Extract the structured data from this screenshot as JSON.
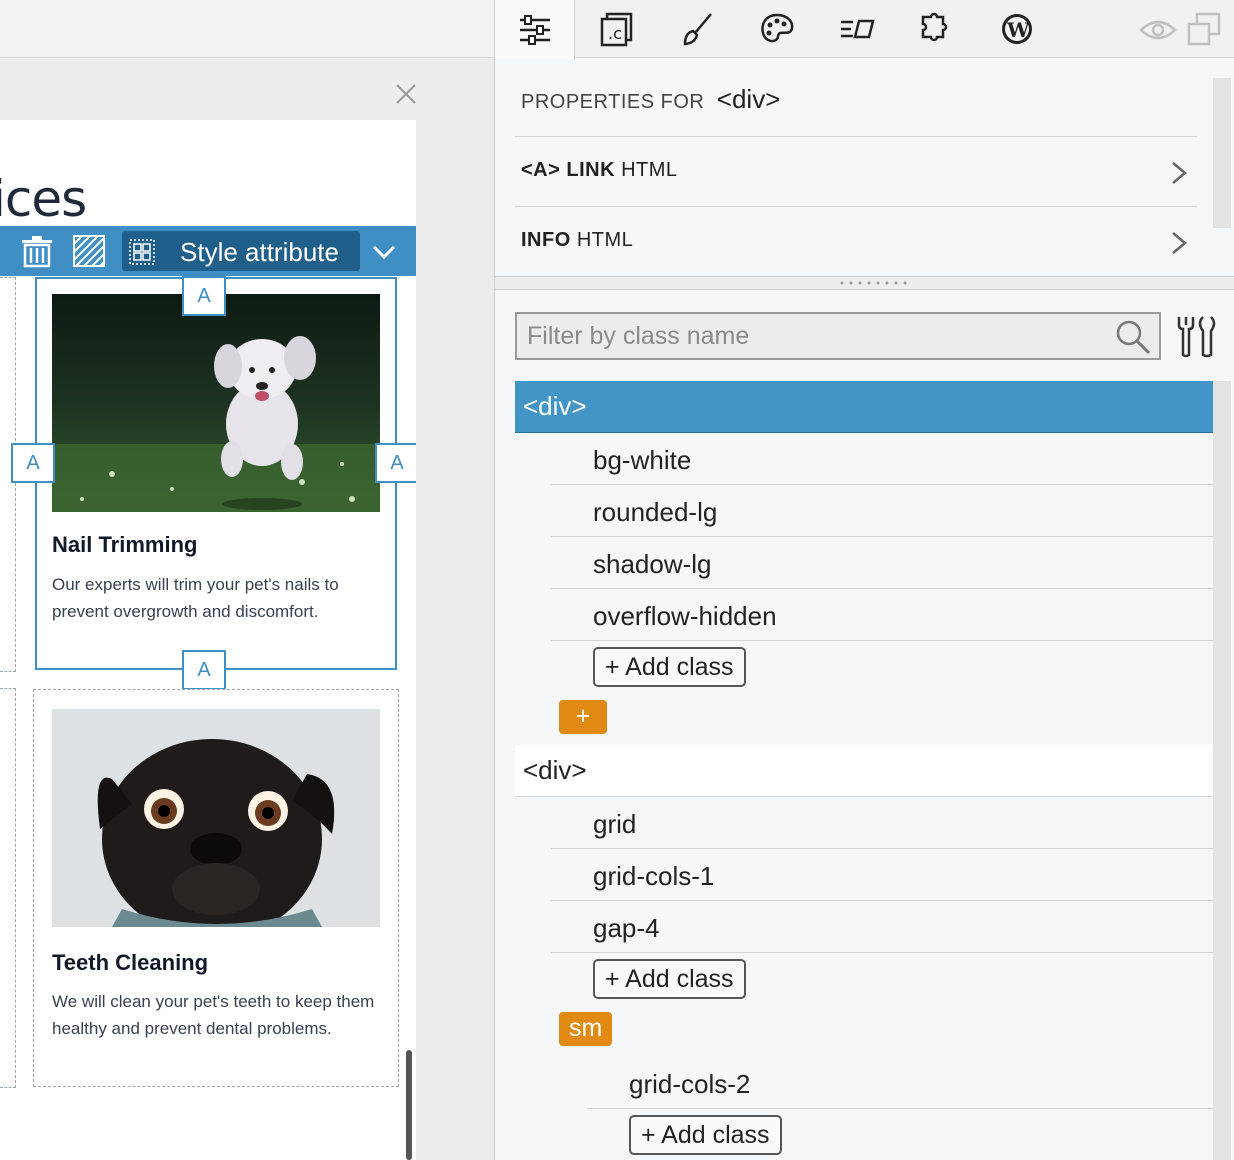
{
  "canvas": {
    "page_heading": "ices",
    "toolbar": {
      "style_label": "Style attribute"
    },
    "handle_label": "A",
    "cards": [
      {
        "title": "Nail Trimming",
        "text": "Our experts will trim your pet's nails to prevent overgrowth and discomfort.",
        "image": "running-dog-photo"
      },
      {
        "title": "Teeth Cleaning",
        "text": "We will clean your pet's teeth to keep them healthy and prevent dental problems.",
        "image": "pug-photo"
      }
    ]
  },
  "panel": {
    "tabs": [
      {
        "icon": "sliders-icon",
        "active": true
      },
      {
        "icon": "css-file-icon",
        "active": false
      },
      {
        "icon": "brush-icon",
        "active": false
      },
      {
        "icon": "palette-icon",
        "active": false
      },
      {
        "icon": "text-format-icon",
        "active": false
      },
      {
        "icon": "puzzle-icon",
        "active": false
      },
      {
        "icon": "wordpress-icon",
        "active": false
      }
    ],
    "properties": {
      "header_label": "PROPERTIES FOR",
      "header_tag": "<div>",
      "rows": [
        {
          "bold": "<A> LINK",
          "rest": "HTML"
        },
        {
          "bold": "INFO",
          "rest": "HTML"
        }
      ]
    },
    "classes": {
      "filter_placeholder": "Filter by class name",
      "nodes": [
        {
          "tag": "<div>",
          "classes": [
            "bg-white",
            "rounded-lg",
            "shadow-lg",
            "overflow-hidden"
          ],
          "add_label": "+ Add class",
          "breakpoint_button": "+"
        },
        {
          "tag": "<div>",
          "classes": [
            "grid",
            "grid-cols-1",
            "gap-4"
          ],
          "add_label": "+ Add class",
          "breakpoint": "sm",
          "breakpoint_classes": [
            "grid-cols-2"
          ],
          "breakpoint_add_label": "+ Add class"
        }
      ]
    }
  },
  "colors": {
    "accent": "#3f8fc4",
    "selected_row": "#4495c7",
    "orange": "#e08a13"
  }
}
